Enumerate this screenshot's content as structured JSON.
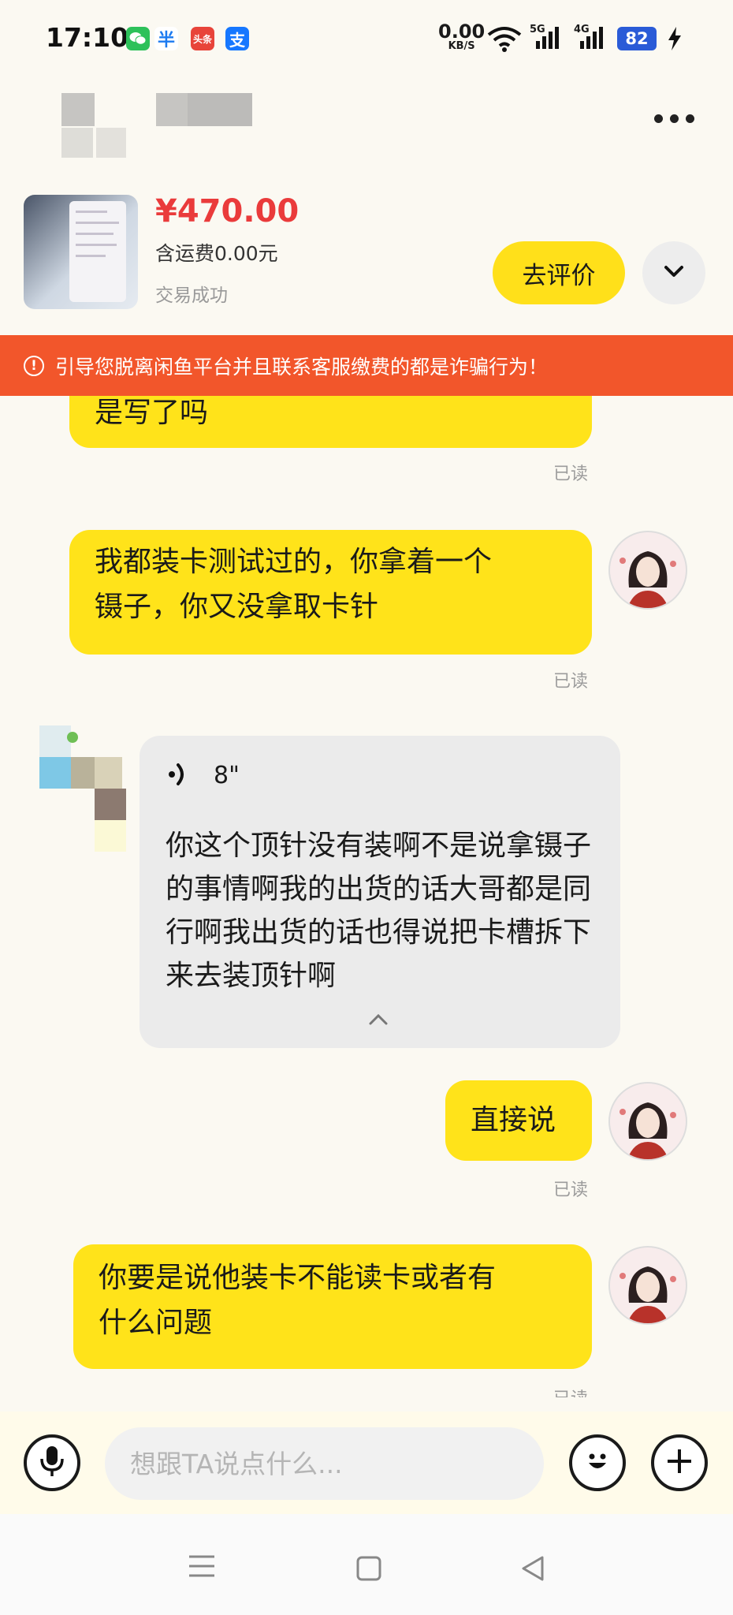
{
  "status_bar": {
    "time": "17:10",
    "net_speed": "0.00",
    "net_unit": "KB/S",
    "sig1": "5G",
    "sig2": "4G",
    "battery": "82",
    "app_icons": [
      "wechat-icon",
      "app-icon-2",
      "toutiao-icon",
      "alipay-icon"
    ],
    "toutiao_label": "头条",
    "alipay_label": "支",
    "app2_label": "半"
  },
  "product": {
    "price": "¥470.00",
    "shipping": "含运费0.00元",
    "status": "交易成功",
    "review_button": "去评价"
  },
  "warning": {
    "text": "引导您脱离闲鱼平台并且联系客服缴费的都是诈骗行为！"
  },
  "messages": {
    "m1": "是写了吗",
    "m1_read": "已读",
    "m2_line1": "我都装卡测试过的，你拿着一个",
    "m2_line2": "镊子，你又没拿取卡针",
    "m2_read": "已读",
    "voice_duration": "8\"",
    "voice_transcript": "你这个顶针没有装啊不是说拿镊子的事情啊我的出货的话大哥都是同行啊我出货的话也得说把卡槽拆下来去装顶针啊",
    "m3": "直接说",
    "m3_read": "已读",
    "m4_line1": "你要是说他装卡不能读卡或者有",
    "m4_line2": "什么问题",
    "m4_read": "已读"
  },
  "input": {
    "placeholder": "想跟TA说点什么..."
  },
  "colors": {
    "accent": "#ffe31a",
    "warning": "#f2562b",
    "price": "#ea3b3b"
  }
}
